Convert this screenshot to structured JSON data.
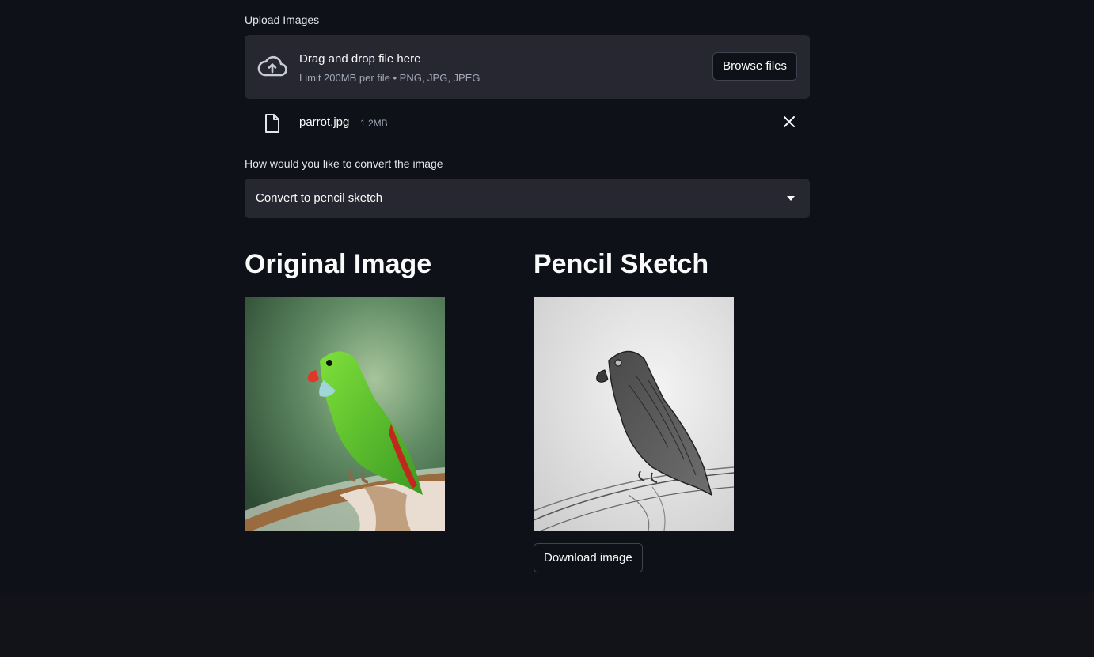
{
  "uploader": {
    "label": "Upload Images",
    "drop_title": "Drag and drop file here",
    "drop_subtitle": "Limit 200MB per file • PNG, JPG, JPEG",
    "browse_label": "Browse files",
    "icon": "cloud-upload-icon"
  },
  "uploaded_file": {
    "name": "parrot.jpg",
    "size": "1.2MB",
    "icon": "file-icon",
    "remove_icon": "close-icon"
  },
  "conversion": {
    "label": "How would you like to convert the image",
    "selected": "Convert to pencil sketch"
  },
  "results": {
    "original_title": "Original Image",
    "sketch_title": "Pencil Sketch",
    "download_label": "Download image"
  },
  "colors": {
    "background": "#0e1117",
    "widget": "#262730",
    "text": "#fafafa",
    "muted": "#a3a8b8"
  }
}
